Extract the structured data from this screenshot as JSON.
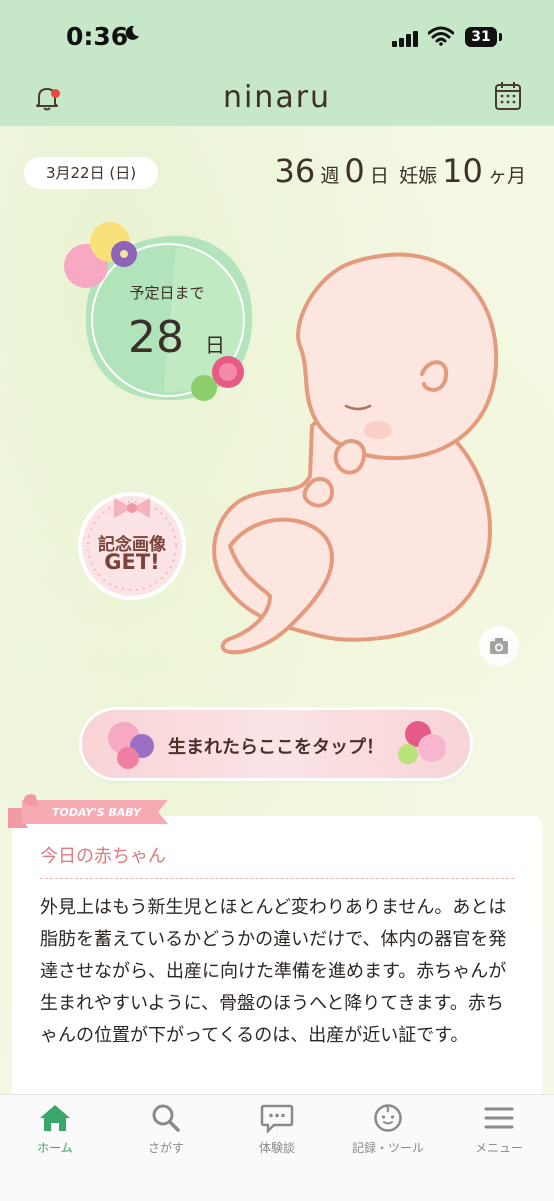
{
  "status_bar": {
    "time": "0:36",
    "battery": "31"
  },
  "header": {
    "logo": "ninaru",
    "notification_dot_color": "#e8473d"
  },
  "summary": {
    "date": "3月22日 (日)",
    "weeks": "36",
    "weeks_unit": "週",
    "days": "0",
    "days_unit": "日",
    "pregnancy_label": "妊娠",
    "months": "10",
    "months_unit": "ヶ月"
  },
  "countdown": {
    "label": "予定日まで",
    "value": "28",
    "unit": "日"
  },
  "memorial": {
    "line1": "記念画像",
    "line2": "GET!"
  },
  "tap_button": {
    "label": "生まれたらここをタップ！"
  },
  "today_baby": {
    "ribbon": "TODAY'S BABY",
    "title": "今日の赤ちゃん",
    "body": "外見上はもう新生児とほとんど変わりありません。あとは脂肪を蓄えているかどうかの違いだけで、体内の器官を発達させながら、出産に向けた準備を進めます。赤ちゃんが生まれやすいように、骨盤のほうへと降りてきます。赤ちゃんの位置が下がってくるのは、出産が近い証です。"
  },
  "tabs": [
    {
      "label": "ホーム",
      "icon": "home-icon",
      "active": true
    },
    {
      "label": "さがす",
      "icon": "search-icon",
      "active": false
    },
    {
      "label": "体験談",
      "icon": "chat-icon",
      "active": false
    },
    {
      "label": "記録・ツール",
      "icon": "baby-face-icon",
      "active": false
    },
    {
      "label": "メニュー",
      "icon": "menu-icon",
      "active": false
    }
  ],
  "colors": {
    "header_bg": "#c7e8c8",
    "accent_green": "#3aa66a",
    "accent_pink": "#e07a80"
  }
}
